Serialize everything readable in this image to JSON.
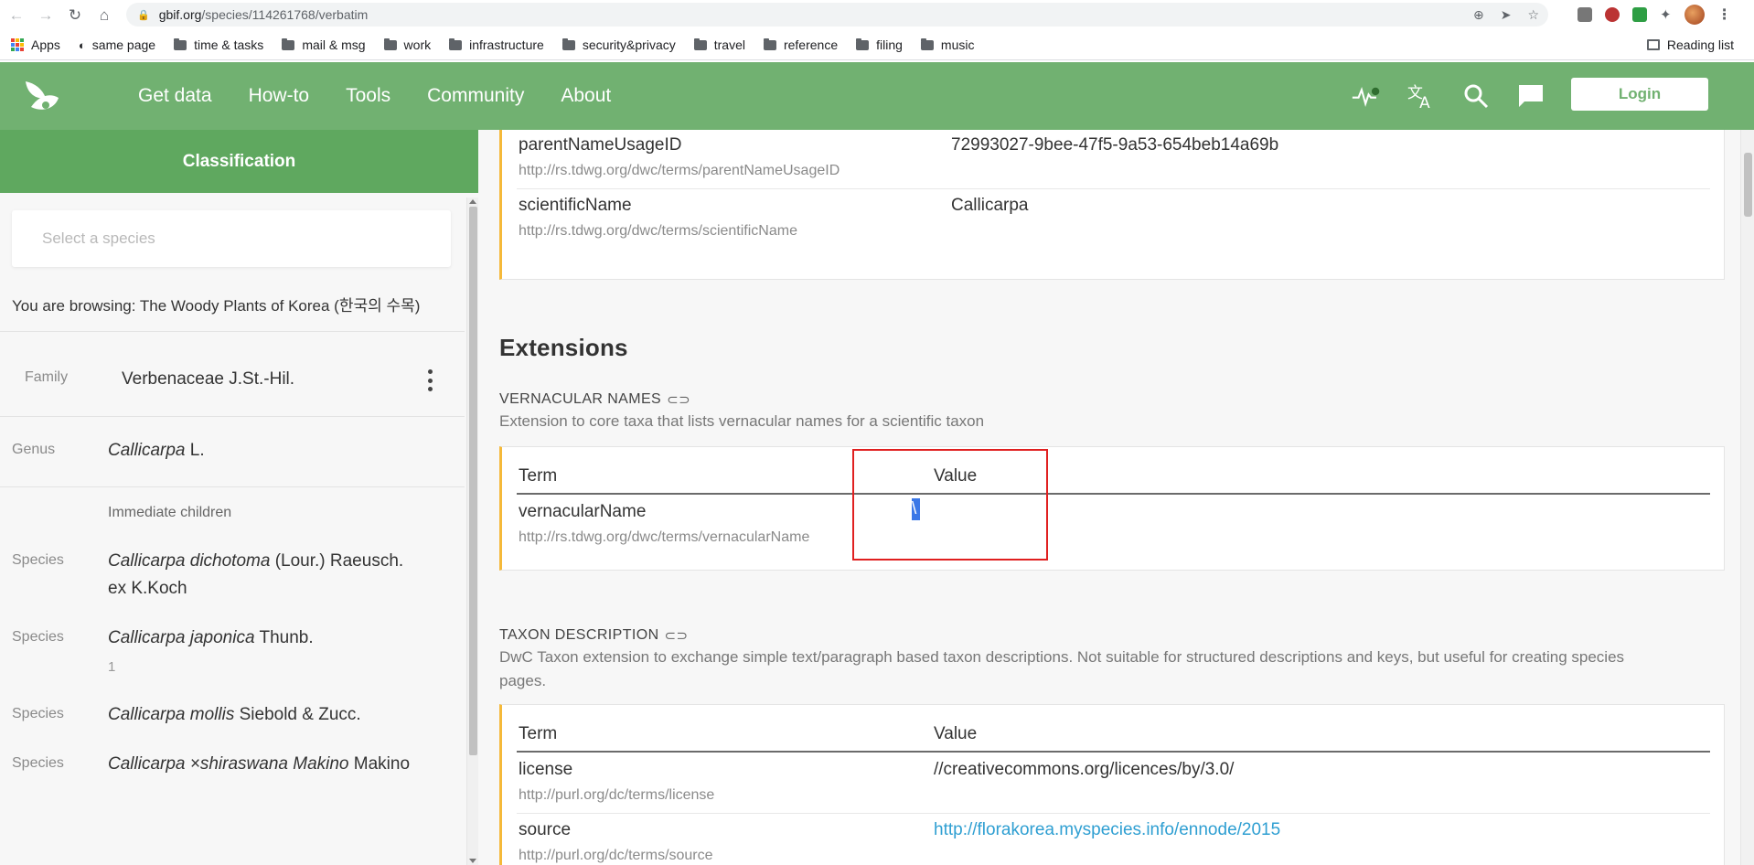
{
  "browser": {
    "url_host": "gbif.org",
    "url_path": "/species/114261768/verbatim",
    "bookmarks": [
      "Apps",
      "same page",
      "time & tasks",
      "mail & msg",
      "work",
      "infrastructure",
      "security&privacy",
      "travel",
      "reference",
      "filing",
      "music"
    ],
    "reading_list": "Reading list"
  },
  "site": {
    "nav": [
      "Get data",
      "How-to",
      "Tools",
      "Community",
      "About"
    ],
    "login": "Login",
    "brand_color": "#71b171"
  },
  "sidebar": {
    "title": "Classification",
    "search_placeholder": "Select a species",
    "browsing": "You are browsing: The Woody Plants of Korea (한국의 수목)",
    "family_rank": "Family",
    "family_name": "Verbenaceae J.St.-Hil.",
    "genus_rank": "Genus",
    "genus_name_italic": "Callicarpa",
    "genus_author": " L.",
    "immediate_children": "Immediate children",
    "species": [
      {
        "rank": "Species",
        "italic": "Callicarpa dichotoma",
        "author_line1": " (Lour.) Raeusch.",
        "author_line2": "ex K.Koch",
        "count": ""
      },
      {
        "rank": "Species",
        "italic": "Callicarpa japonica",
        "author_line1": " Thunb.",
        "author_line2": "",
        "count": "1"
      },
      {
        "rank": "Species",
        "italic": "Callicarpa mollis",
        "author_line1": " Siebold & Zucc.",
        "author_line2": "",
        "count": ""
      },
      {
        "rank": "Species",
        "italic": "Callicarpa ×shiraswana Makino",
        "author_line1": " Makino",
        "author_line2": "",
        "count": ""
      }
    ]
  },
  "core": {
    "rows": [
      {
        "term": "parentNameUsageID",
        "uri": "http://rs.tdwg.org/dwc/terms/parentNameUsageID",
        "value": "72993027-9bee-47f5-9a53-654beb14a69b"
      },
      {
        "term": "scientificName",
        "uri": "http://rs.tdwg.org/dwc/terms/scientificName",
        "value": "Callicarpa"
      }
    ]
  },
  "extensions": {
    "title": "Extensions",
    "vernacular": {
      "label": "VERNACULAR NAMES",
      "desc": "Extension to core taxa that lists vernacular names for a scientific taxon",
      "col_term": "Term",
      "col_value": "Value",
      "term": "vernacularName",
      "uri": "http://rs.tdwg.org/dwc/terms/vernacularName",
      "value": "\\"
    },
    "taxon_description": {
      "label": "TAXON DESCRIPTION",
      "desc_line1": "DwC Taxon extension to exchange simple text/paragraph based taxon descriptions. Not suitable for structured descriptions and keys, but useful for creating species",
      "desc_line2": "pages.",
      "col_term": "Term",
      "col_value": "Value",
      "rows": [
        {
          "term": "license",
          "uri": "http://purl.org/dc/terms/license",
          "value": "//creativecommons.org/licences/by/3.0/"
        },
        {
          "term": "source",
          "uri": "http://purl.org/dc/terms/source",
          "value": "http://florakorea.myspecies.info/ennode/2015"
        }
      ]
    }
  }
}
